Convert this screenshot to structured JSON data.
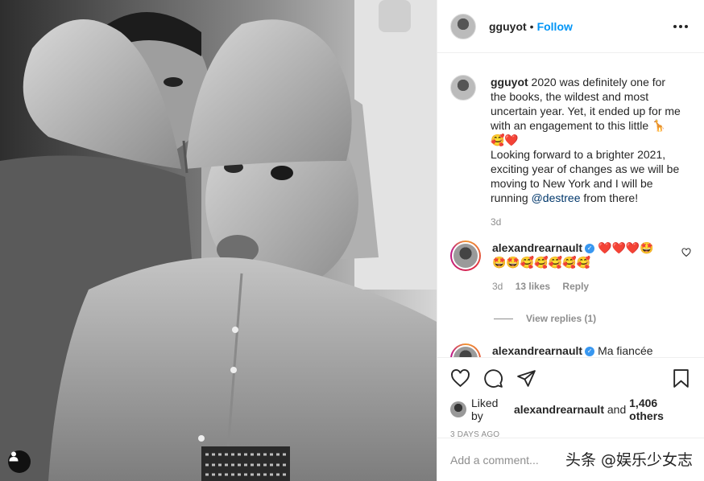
{
  "post": {
    "username": "gguyot",
    "header_separator": "•",
    "follow_label": "Follow"
  },
  "caption": {
    "username": "gguyot",
    "text_part1": "2020 was definitely one for the books, the wildest and most uncertain year. Yet, it ended up for me with an engagement to this little 🦒",
    "text_emojis1": "🥰❤️",
    "text_part2": "Looking forward to a brighter 2021, exciting year of changes as we will be moving to New York and I will be running",
    "mention": "@destree",
    "text_part3": "from there!",
    "time": "3d"
  },
  "comments": [
    {
      "username": "alexandrearnault",
      "verified": true,
      "text_line1": "❤️❤️❤️🤩",
      "text_line2": "🤩🤩🥰🥰🥰🥰🥰",
      "time": "3d",
      "likes": "13 likes",
      "reply_label": "Reply",
      "view_replies": "View replies (1)"
    },
    {
      "username": "alexandrearnault",
      "verified": true,
      "text": "Ma fiancée"
    }
  ],
  "likes": {
    "prefix": "Liked by",
    "user": "alexandrearnault",
    "connector": "and",
    "others": "1,406 others"
  },
  "date": "3 DAYS AGO",
  "add_comment": {
    "placeholder": "Add a comment..."
  },
  "watermark": "头条 @娱乐少女志",
  "icons": {
    "like": "heart-icon",
    "comment": "comment-icon",
    "share": "share-icon",
    "save": "bookmark-icon",
    "more": "more-options-icon",
    "user_tag": "user-tag-icon"
  },
  "colors": {
    "link_blue": "#0095f6",
    "text": "#262626",
    "muted": "#8e8e8e",
    "verified": "#3897f0"
  }
}
